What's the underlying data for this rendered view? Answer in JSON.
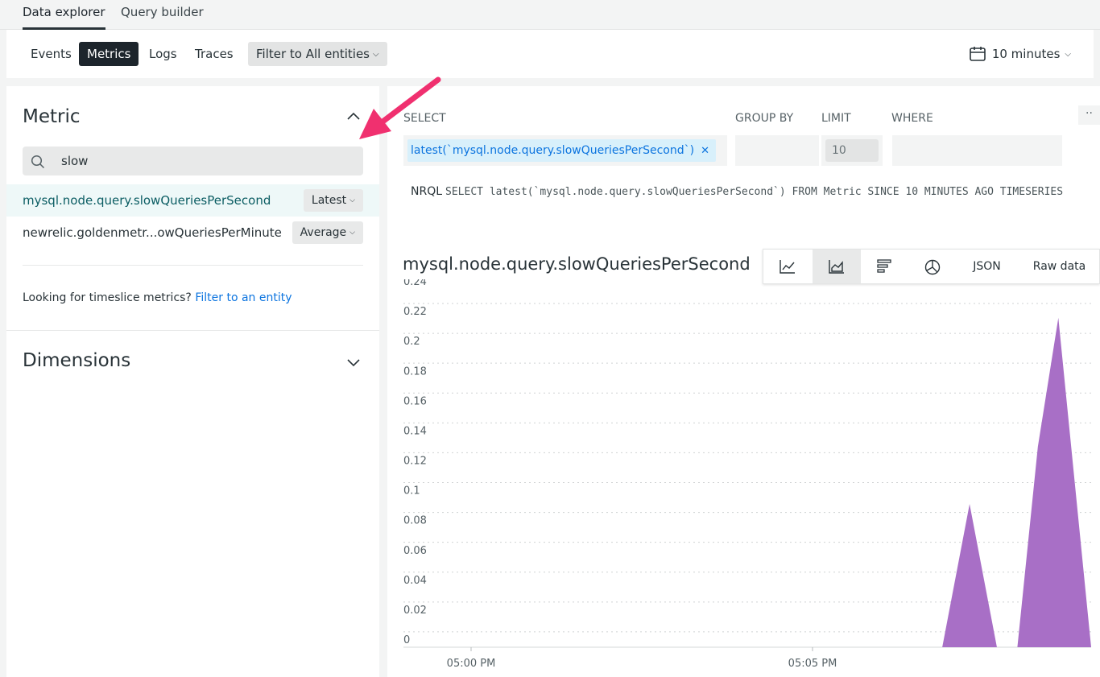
{
  "top_tabs": {
    "data_explorer": "Data explorer",
    "query_builder": "Query builder"
  },
  "filter_bar": {
    "tabs": [
      "Events",
      "Metrics",
      "Logs",
      "Traces"
    ],
    "active_tab": "Metrics",
    "filter_label": "Filter to All entities",
    "time_range": "10 minutes"
  },
  "metric_panel": {
    "title": "Metric",
    "search_value": "slow",
    "metrics": [
      {
        "name": "mysql.node.query.slowQueriesPerSecond",
        "aggregation": "Latest",
        "selected": true
      },
      {
        "name": "newrelic.goldenmetr...owQueriesPerMinute",
        "aggregation": "Average",
        "selected": false
      }
    ],
    "timeslice_text": "Looking for timeslice metrics?",
    "timeslice_link": "Filter to an entity",
    "dimensions_title": "Dimensions"
  },
  "query": {
    "select_label": "SELECT",
    "group_by_label": "GROUP BY",
    "limit_label": "LIMIT",
    "where_label": "WHERE",
    "select_chip": "latest(`mysql.node.query.slowQueriesPerSecond`)",
    "limit_value": "10",
    "more": "··",
    "nrql_label": "NRQL",
    "nrql": "SELECT latest(`mysql.node.query.slowQueriesPerSecond`) FROM Metric SINCE 10 MINUTES AGO TIMESERIES"
  },
  "chart_toolbar": {
    "icons": [
      "line-chart-icon",
      "area-chart-icon",
      "bar-chart-icon",
      "pie-chart-icon"
    ],
    "json_label": "JSON",
    "raw_label": "Raw data"
  },
  "chart_data": {
    "type": "area",
    "title": "mysql.node.query.slowQueriesPerSecond",
    "color": "#a86fc6",
    "ylim": [
      0,
      0.24
    ],
    "yticks": [
      "0.24",
      "0.22",
      "0.2",
      "0.18",
      "0.16",
      "0.14",
      "0.12",
      "0.1",
      "0.08",
      "0.06",
      "0.04",
      "0.02",
      "0"
    ],
    "xticks": [
      "05:00 PM",
      "05:05 PM"
    ],
    "x_minutes": [
      0,
      6.9,
      7.3,
      7.7,
      8.0,
      8.3,
      8.6,
      9.1,
      9.6,
      10.0
    ],
    "values": [
      0,
      0,
      0.1,
      0,
      0,
      0.14,
      0.23,
      0,
      0.02,
      0.02
    ],
    "x_start_minute_offset": -1.0,
    "grid": true
  }
}
